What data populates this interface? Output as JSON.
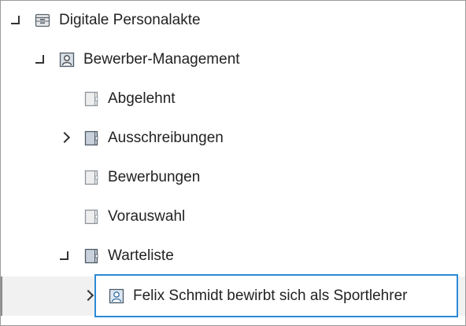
{
  "tree": {
    "root": {
      "label": "Digitale Personalakte",
      "icon": "cabinet-icon",
      "state": "expanded"
    },
    "group": {
      "label": "Bewerber-Management",
      "icon": "person-folder-icon",
      "state": "expanded"
    },
    "items": [
      {
        "label": "Abgelehnt",
        "icon": "document-icon",
        "state": "leaf"
      },
      {
        "label": "Ausschreibungen",
        "icon": "folder-icon",
        "state": "collapsed"
      },
      {
        "label": "Bewerbungen",
        "icon": "document-icon",
        "state": "leaf"
      },
      {
        "label": "Vorauswahl",
        "icon": "document-icon",
        "state": "leaf"
      },
      {
        "label": "Warteliste",
        "icon": "folder-icon",
        "state": "expanded"
      }
    ],
    "selected": {
      "label": "Felix Schmidt bewirbt sich als Sportlehrer",
      "icon": "person-file-icon",
      "state": "collapsed"
    }
  },
  "colors": {
    "selection_border": "#2a8ad8",
    "hover_bg": "#f1f1f1",
    "text": "#222222"
  }
}
